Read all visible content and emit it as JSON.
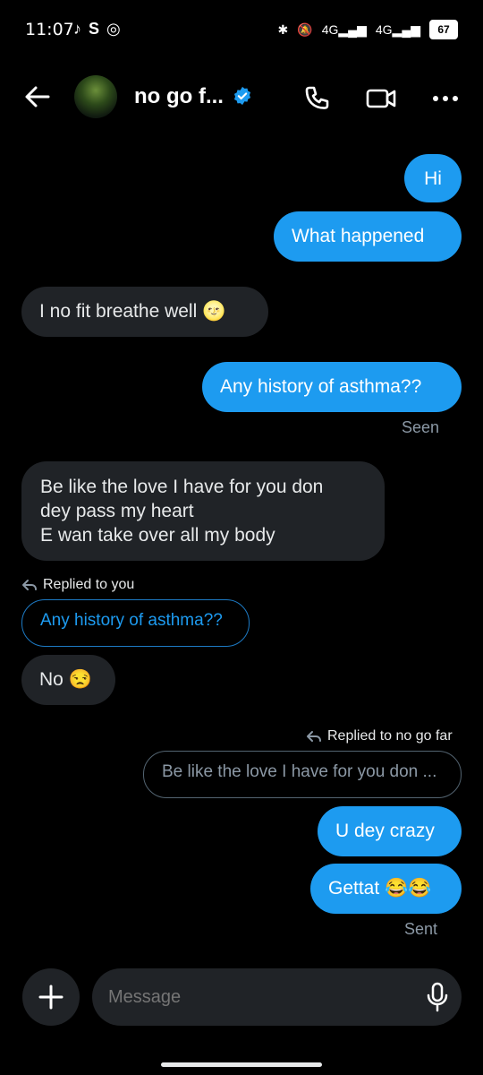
{
  "status": {
    "time": "11:07",
    "network1": "4G",
    "network2": "4G",
    "battery": "67"
  },
  "header": {
    "title": "no go f..."
  },
  "messages": [
    {
      "text": "Hi"
    },
    {
      "text": "What happened"
    },
    {
      "text": "I no fit breathe well 🌝"
    },
    {
      "text": "Any history of asthma??"
    },
    {
      "text": "Seen"
    },
    {
      "text": "Be like the love I have for you don"
    },
    {
      "text": "dey pass my heart"
    },
    {
      "text": "E wan take over all my body"
    },
    {
      "text": "Replied to you"
    },
    {
      "text": "Any history of asthma??"
    },
    {
      "text": "No 😒"
    },
    {
      "text": "Replied to no go far"
    },
    {
      "text": "Be like the love I have for you don ..."
    },
    {
      "text": "U dey crazy"
    },
    {
      "text": "Gettat 😂😂"
    },
    {
      "text": "Sent"
    }
  ],
  "composer": {
    "placeholder": "Message"
  },
  "colors": {
    "accent": "#1d9bf0",
    "incoming_bubble": "#202327",
    "background": "#000000"
  }
}
